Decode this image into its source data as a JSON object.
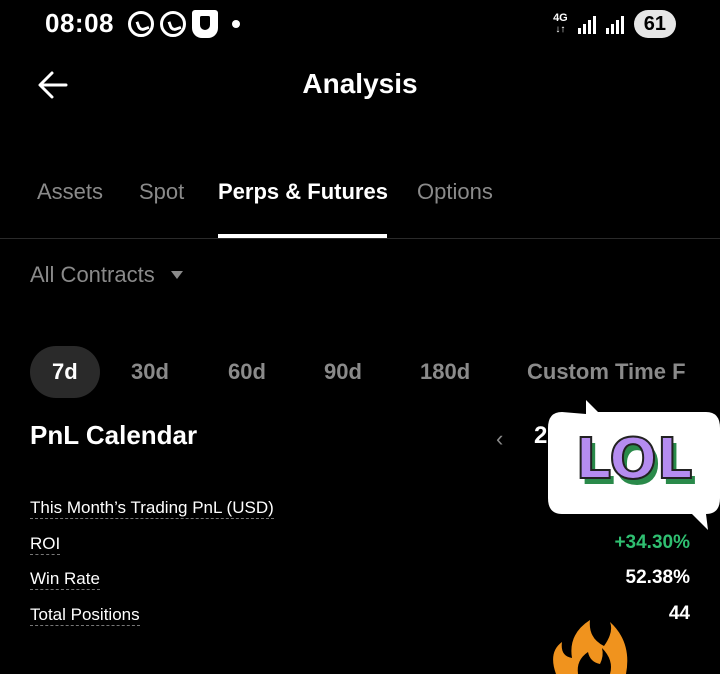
{
  "status_bar": {
    "time": "08:08",
    "network": "4G",
    "battery": "61",
    "icons": [
      "whatsapp-icon",
      "whatsapp-icon",
      "shield-icon",
      "notification-dot",
      "signal-icon",
      "signal-icon"
    ]
  },
  "header": {
    "title": "Analysis"
  },
  "tabs": [
    {
      "label": "Assets"
    },
    {
      "label": "Spot"
    },
    {
      "label": "Perps & Futures",
      "active": true
    },
    {
      "label": "Options"
    }
  ],
  "contracts": {
    "selected": "All Contracts"
  },
  "periods": [
    {
      "label": "7d",
      "active": true
    },
    {
      "label": "30d"
    },
    {
      "label": "60d"
    },
    {
      "label": "90d"
    },
    {
      "label": "180d"
    },
    {
      "label": "Custom Time F"
    }
  ],
  "calendar": {
    "title": "PnL Calendar",
    "year_partial": "2"
  },
  "stats": [
    {
      "label": "This Month’s Trading PnL (USD)",
      "value": ""
    },
    {
      "label": "ROI",
      "value": "+34.30%"
    },
    {
      "label": "Win Rate",
      "value": "52.38%"
    },
    {
      "label": "Total Positions",
      "value": "44"
    }
  ],
  "sticker": {
    "text": "LOL"
  },
  "colors": {
    "positive": "#2fbf71",
    "muted": "#8a8a8a",
    "background": "#000000",
    "active_pill": "#2a2a2a"
  }
}
